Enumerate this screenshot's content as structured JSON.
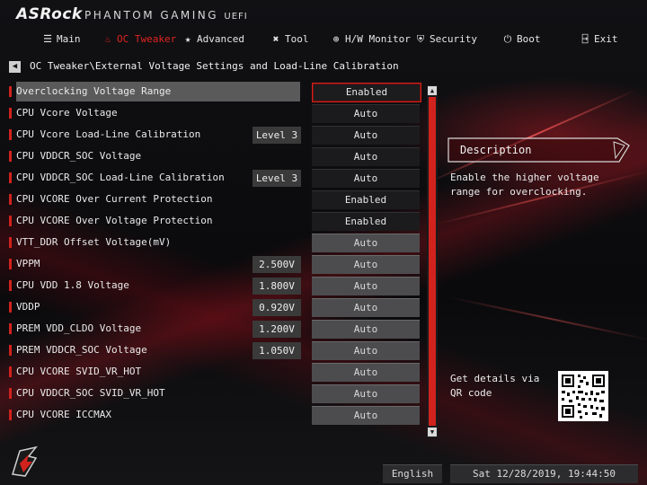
{
  "header": {
    "brand": "ASRock",
    "product": "PHANTOM GAMING",
    "uefi": "UEFI"
  },
  "tabs": [
    {
      "label": "Main",
      "icon": "menu-icon",
      "active": false
    },
    {
      "label": "OC Tweaker",
      "icon": "flame-icon",
      "active": true
    },
    {
      "label": "Advanced",
      "icon": "star-icon",
      "active": false
    },
    {
      "label": "Tool",
      "icon": "tools-icon",
      "active": false
    },
    {
      "label": "H/W Monitor",
      "icon": "monitor-icon",
      "active": false
    },
    {
      "label": "Security",
      "icon": "shield-icon",
      "active": false
    },
    {
      "label": "Boot",
      "icon": "power-icon",
      "active": false
    },
    {
      "label": "Exit",
      "icon": "exit-icon",
      "active": false
    }
  ],
  "breadcrumb": "OC Tweaker\\External Voltage Settings and Load-Line Calibration",
  "settings": [
    {
      "label": "Overclocking Voltage Range",
      "level": "",
      "value": "Enabled",
      "style": "sel"
    },
    {
      "label": "CPU Vcore Voltage",
      "level": "",
      "value": "Auto",
      "style": "dark"
    },
    {
      "label": "CPU Vcore Load-Line Calibration",
      "level": "Level 3",
      "value": "Auto",
      "style": "dark"
    },
    {
      "label": "CPU VDDCR_SOC Voltage",
      "level": "",
      "value": "Auto",
      "style": "dark"
    },
    {
      "label": "CPU VDDCR_SOC Load-Line Calibration",
      "level": "Level 3",
      "value": "Auto",
      "style": "dark"
    },
    {
      "label": "CPU VCORE Over Current Protection",
      "level": "",
      "value": "Enabled",
      "style": "dark"
    },
    {
      "label": "CPU VCORE Over Voltage Protection",
      "level": "",
      "value": "Enabled",
      "style": "dark"
    },
    {
      "label": "VTT_DDR Offset Voltage(mV)",
      "level": "",
      "value": "Auto",
      "style": "grey"
    },
    {
      "label": "VPPM",
      "level": "2.500V",
      "value": "Auto",
      "style": "grey"
    },
    {
      "label": "CPU VDD 1.8 Voltage",
      "level": "1.800V",
      "value": "Auto",
      "style": "grey"
    },
    {
      "label": "VDDP",
      "level": "0.920V",
      "value": "Auto",
      "style": "grey"
    },
    {
      "label": "PREM VDD_CLDO Voltage",
      "level": "1.200V",
      "value": "Auto",
      "style": "grey"
    },
    {
      "label": "PREM VDDCR_SOC Voltage",
      "level": "1.050V",
      "value": "Auto",
      "style": "grey"
    },
    {
      "label": "CPU VCORE SVID_VR_HOT",
      "level": "",
      "value": "Auto",
      "style": "grey"
    },
    {
      "label": "CPU VDDCR_SOC SVID_VR_HOT",
      "level": "",
      "value": "Auto",
      "style": "grey"
    },
    {
      "label": "CPU VCORE ICCMAX",
      "level": "",
      "value": "Auto",
      "style": "grey"
    }
  ],
  "description": {
    "title": "Description",
    "text": "Enable the higher voltage range for overclocking."
  },
  "qr": {
    "text": "Get details via QR code"
  },
  "footer": {
    "language": "English",
    "datetime": "Sat 12/28/2019, 19:44:50"
  },
  "colors": {
    "accent": "#d1221d",
    "background": "#0b0b0d"
  }
}
